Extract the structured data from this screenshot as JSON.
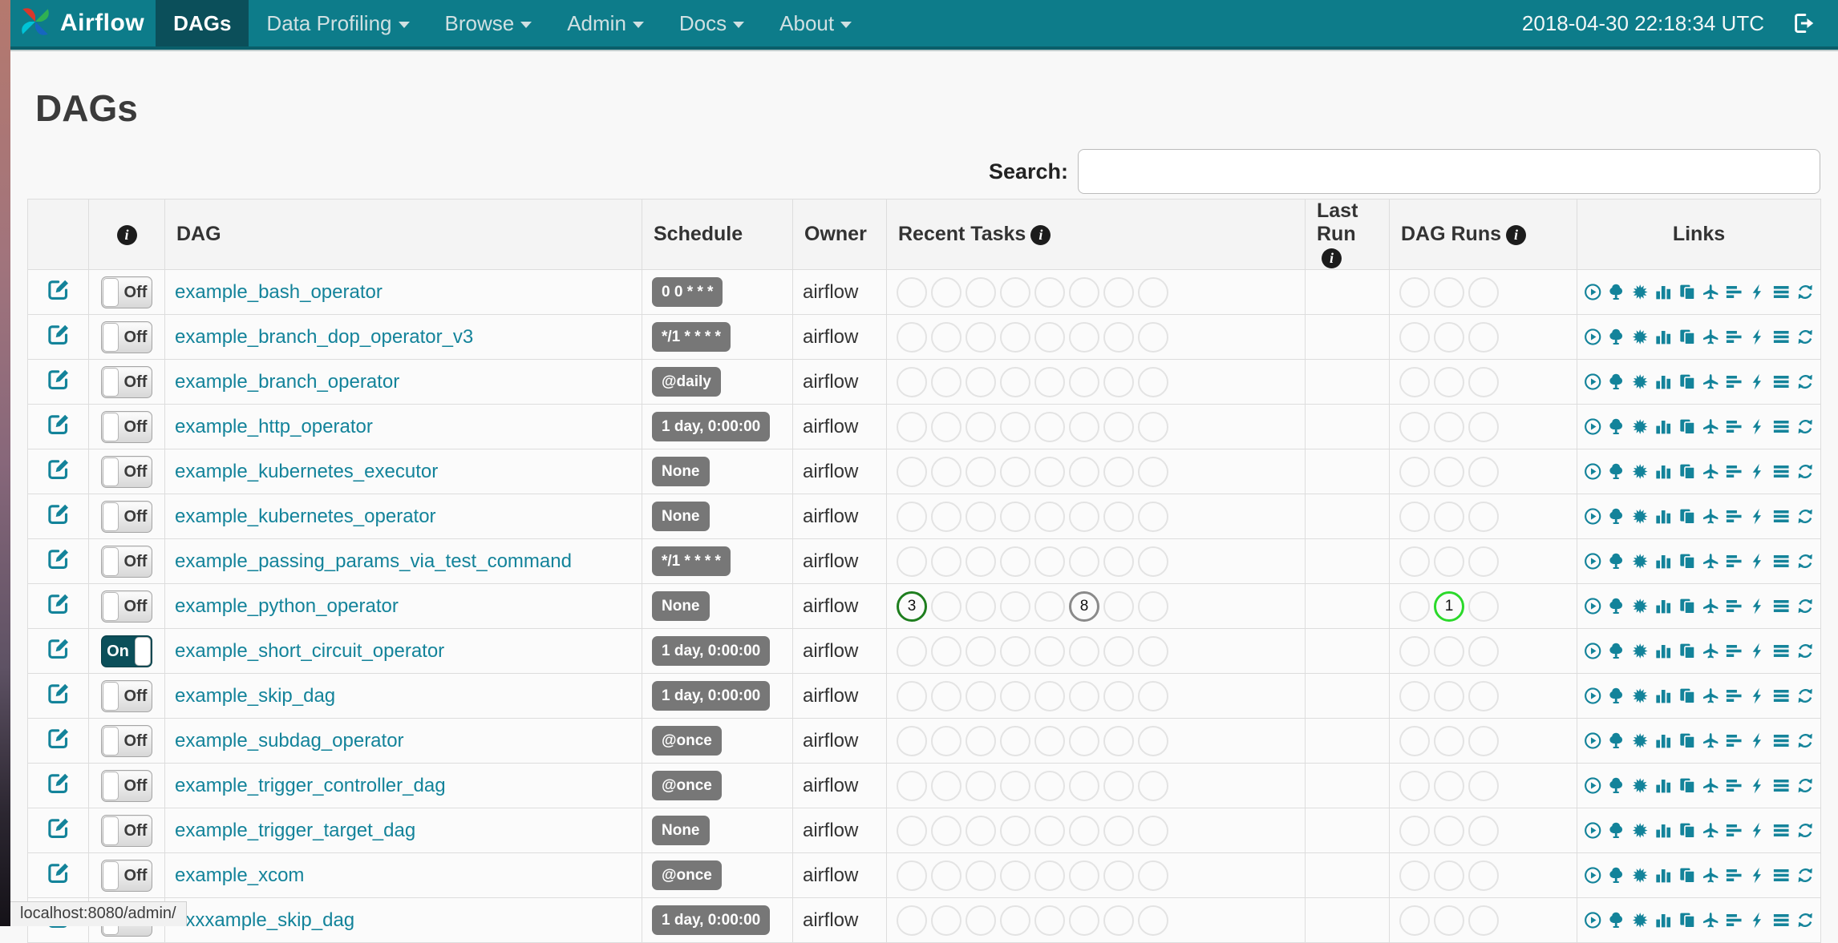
{
  "navbar": {
    "brand": "Airflow",
    "items": [
      {
        "label": "DAGs",
        "active": true,
        "caret": false
      },
      {
        "label": "Data Profiling",
        "active": false,
        "caret": true
      },
      {
        "label": "Browse",
        "active": false,
        "caret": true
      },
      {
        "label": "Admin",
        "active": false,
        "caret": true
      },
      {
        "label": "Docs",
        "active": false,
        "caret": true
      },
      {
        "label": "About",
        "active": false,
        "caret": true
      }
    ],
    "clock": "2018-04-30 22:18:34 UTC",
    "icons": [
      "airflow-pinwheel-logo",
      "sign-out-icon"
    ]
  },
  "page": {
    "title": "DAGs"
  },
  "search": {
    "label": "Search:",
    "value": ""
  },
  "table": {
    "headers": {
      "edit": "",
      "info_icon": "info-icon",
      "dag": "DAG",
      "schedule": "Schedule",
      "owner": "Owner",
      "recent_tasks": "Recent Tasks",
      "last_run": "Last Run",
      "dag_runs": "DAG Runs",
      "links": "Links"
    },
    "recent_task_slots": 8,
    "dag_run_slots": 3,
    "link_icons": [
      "trigger-dag-play-icon",
      "tree-view-icon",
      "graph-view-icon",
      "task-duration-chart-icon",
      "task-tries-icon",
      "landing-times-plane-icon",
      "gantt-view-icon",
      "code-view-bolt-icon",
      "logs-icon",
      "refresh-icon"
    ],
    "rows": [
      {
        "toggle": "Off",
        "name": "example_bash_operator",
        "schedule": "0 0 * * *",
        "owner": "airflow",
        "recent_tasks": [],
        "dag_runs": []
      },
      {
        "toggle": "Off",
        "name": "example_branch_dop_operator_v3",
        "schedule": "*/1 * * * *",
        "owner": "airflow",
        "recent_tasks": [],
        "dag_runs": []
      },
      {
        "toggle": "Off",
        "name": "example_branch_operator",
        "schedule": "@daily",
        "owner": "airflow",
        "recent_tasks": [],
        "dag_runs": []
      },
      {
        "toggle": "Off",
        "name": "example_http_operator",
        "schedule": "1 day, 0:00:00",
        "owner": "airflow",
        "recent_tasks": [],
        "dag_runs": []
      },
      {
        "toggle": "Off",
        "name": "example_kubernetes_executor",
        "schedule": "None",
        "owner": "airflow",
        "recent_tasks": [],
        "dag_runs": []
      },
      {
        "toggle": "Off",
        "name": "example_kubernetes_operator",
        "schedule": "None",
        "owner": "airflow",
        "recent_tasks": [],
        "dag_runs": []
      },
      {
        "toggle": "Off",
        "name": "example_passing_params_via_test_command",
        "schedule": "*/1 * * * *",
        "owner": "airflow",
        "recent_tasks": [],
        "dag_runs": []
      },
      {
        "toggle": "Off",
        "name": "example_python_operator",
        "schedule": "None",
        "owner": "airflow",
        "recent_tasks": [
          {
            "slot": 0,
            "count": "3",
            "state": "success"
          },
          {
            "slot": 5,
            "count": "8",
            "state": "queued"
          }
        ],
        "dag_runs": [
          {
            "slot": 1,
            "count": "1",
            "state": "running"
          }
        ]
      },
      {
        "toggle": "On",
        "name": "example_short_circuit_operator",
        "schedule": "1 day, 0:00:00",
        "owner": "airflow",
        "recent_tasks": [],
        "dag_runs": []
      },
      {
        "toggle": "Off",
        "name": "example_skip_dag",
        "schedule": "1 day, 0:00:00",
        "owner": "airflow",
        "recent_tasks": [],
        "dag_runs": []
      },
      {
        "toggle": "Off",
        "name": "example_subdag_operator",
        "schedule": "@once",
        "owner": "airflow",
        "recent_tasks": [],
        "dag_runs": []
      },
      {
        "toggle": "Off",
        "name": "example_trigger_controller_dag",
        "schedule": "@once",
        "owner": "airflow",
        "recent_tasks": [],
        "dag_runs": []
      },
      {
        "toggle": "Off",
        "name": "example_trigger_target_dag",
        "schedule": "None",
        "owner": "airflow",
        "recent_tasks": [],
        "dag_runs": []
      },
      {
        "toggle": "Off",
        "name": "example_xcom",
        "schedule": "@once",
        "owner": "airflow",
        "recent_tasks": [],
        "dag_runs": []
      },
      {
        "toggle": "Off",
        "name": "exxxample_skip_dag",
        "schedule": "1 day, 0:00:00",
        "owner": "airflow",
        "recent_tasks": [],
        "dag_runs": []
      }
    ]
  },
  "status_bar": {
    "text": "localhost:8080/admin/"
  },
  "colors": {
    "navbar": "#0d7c8a",
    "navbar_active": "#0b4f5a",
    "accent_teal": "#13839a",
    "badge_gray": "#777777",
    "circle_border": "#e3e3e3",
    "states": {
      "success": "#1e7e1e",
      "running": "#2bd92b",
      "queued": "#8a8a8a"
    }
  }
}
